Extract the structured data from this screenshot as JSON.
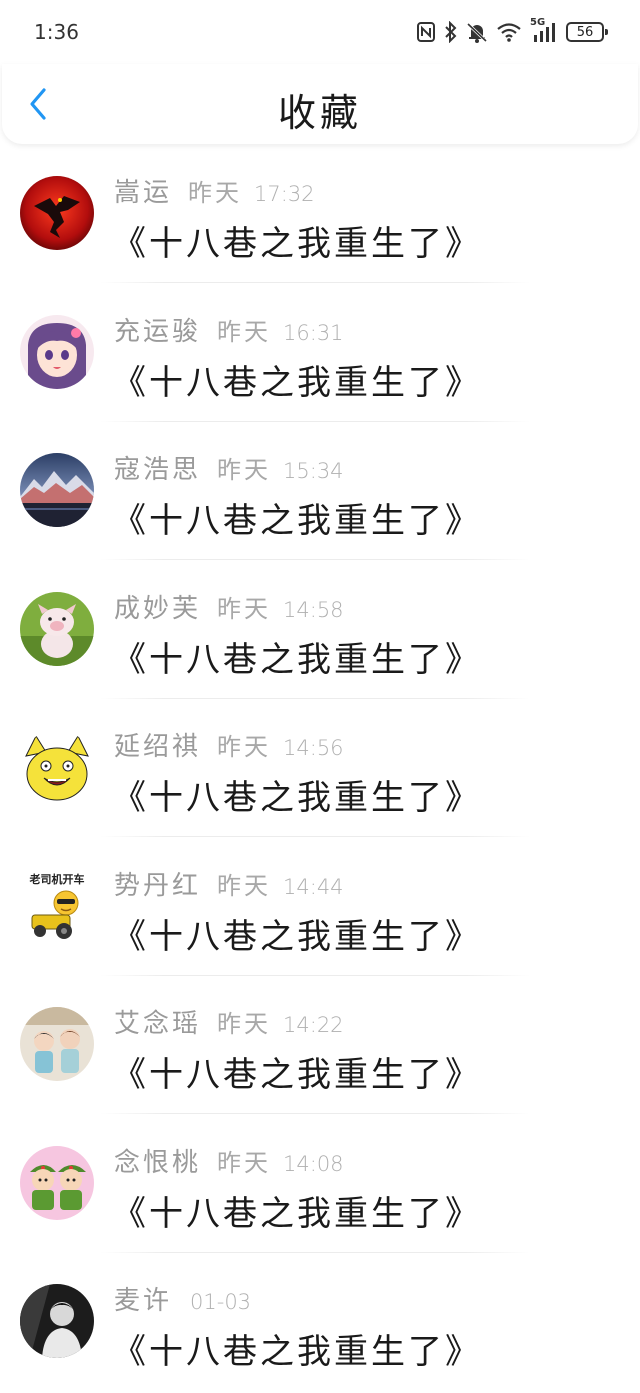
{
  "status_bar": {
    "time": "1:36",
    "network": "5G",
    "battery": "56",
    "icons": [
      "nfc-icon",
      "bluetooth-icon",
      "mute-bell-icon",
      "wifi-icon",
      "signal-icon",
      "battery-icon"
    ]
  },
  "header": {
    "title": "收藏",
    "back_icon": "chevron-left-icon",
    "accent": "#2196f3"
  },
  "items": [
    {
      "name": "嵩运",
      "day": "昨天",
      "time": "17:32",
      "content": "《十八巷之我重生了》",
      "avatar": "dragon-avatar"
    },
    {
      "name": "充运骏",
      "day": "昨天",
      "time": "16:31",
      "content": "《十八巷之我重生了》",
      "avatar": "anime-girl-avatar"
    },
    {
      "name": "寇浩思",
      "day": "昨天",
      "time": "15:34",
      "content": "《十八巷之我重生了》",
      "avatar": "mountain-avatar"
    },
    {
      "name": "成妙芙",
      "day": "昨天",
      "time": "14:58",
      "content": "《十八巷之我重生了》",
      "avatar": "pig-plush-avatar"
    },
    {
      "name": "延绍祺",
      "day": "昨天",
      "time": "14:56",
      "content": "《十八巷之我重生了》",
      "avatar": "rage-face-avatar"
    },
    {
      "name": "势丹红",
      "day": "昨天",
      "time": "14:44",
      "content": "《十八巷之我重生了》",
      "avatar": "driver-emoji-avatar",
      "avatar_text": "老司机开车"
    },
    {
      "name": "艾念瑶",
      "day": "昨天",
      "time": "14:22",
      "content": "《十八巷之我重生了》",
      "avatar": "cartoon-kids-avatar"
    },
    {
      "name": "念恨桃",
      "day": "昨天",
      "time": "14:08",
      "content": "《十八巷之我重生了》",
      "avatar": "soldier-kids-avatar"
    },
    {
      "name": "麦许",
      "day": "",
      "time": "01-03",
      "content": "《十八巷之我重生了》",
      "avatar": "portrait-avatar"
    }
  ]
}
